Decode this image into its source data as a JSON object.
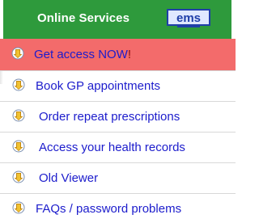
{
  "header": {
    "title": "Online Services",
    "logo_text": "ems",
    "logo_icon": "ems-logo"
  },
  "menu": {
    "items": [
      {
        "label": "Get access NOW",
        "suffix": "!",
        "icon": "arrow-down-circle-icon",
        "highlighted": true
      },
      {
        "label": "Book GP appointments",
        "icon": "arrow-down-circle-icon"
      },
      {
        "label": "Order repeat prescriptions",
        "icon": "arrow-down-circle-icon"
      },
      {
        "label": "Access your health records",
        "icon": "arrow-down-circle-icon"
      },
      {
        "label": "Old Viewer",
        "icon": "arrow-down-circle-icon"
      },
      {
        "label": "FAQs / password problems",
        "icon": "arrow-down-circle-icon"
      }
    ]
  },
  "colors": {
    "header_bg": "#2e9a3c",
    "highlight_bg": "#f36b6b",
    "link": "#1c1ccc",
    "logo_blue": "#1f3fa8"
  }
}
